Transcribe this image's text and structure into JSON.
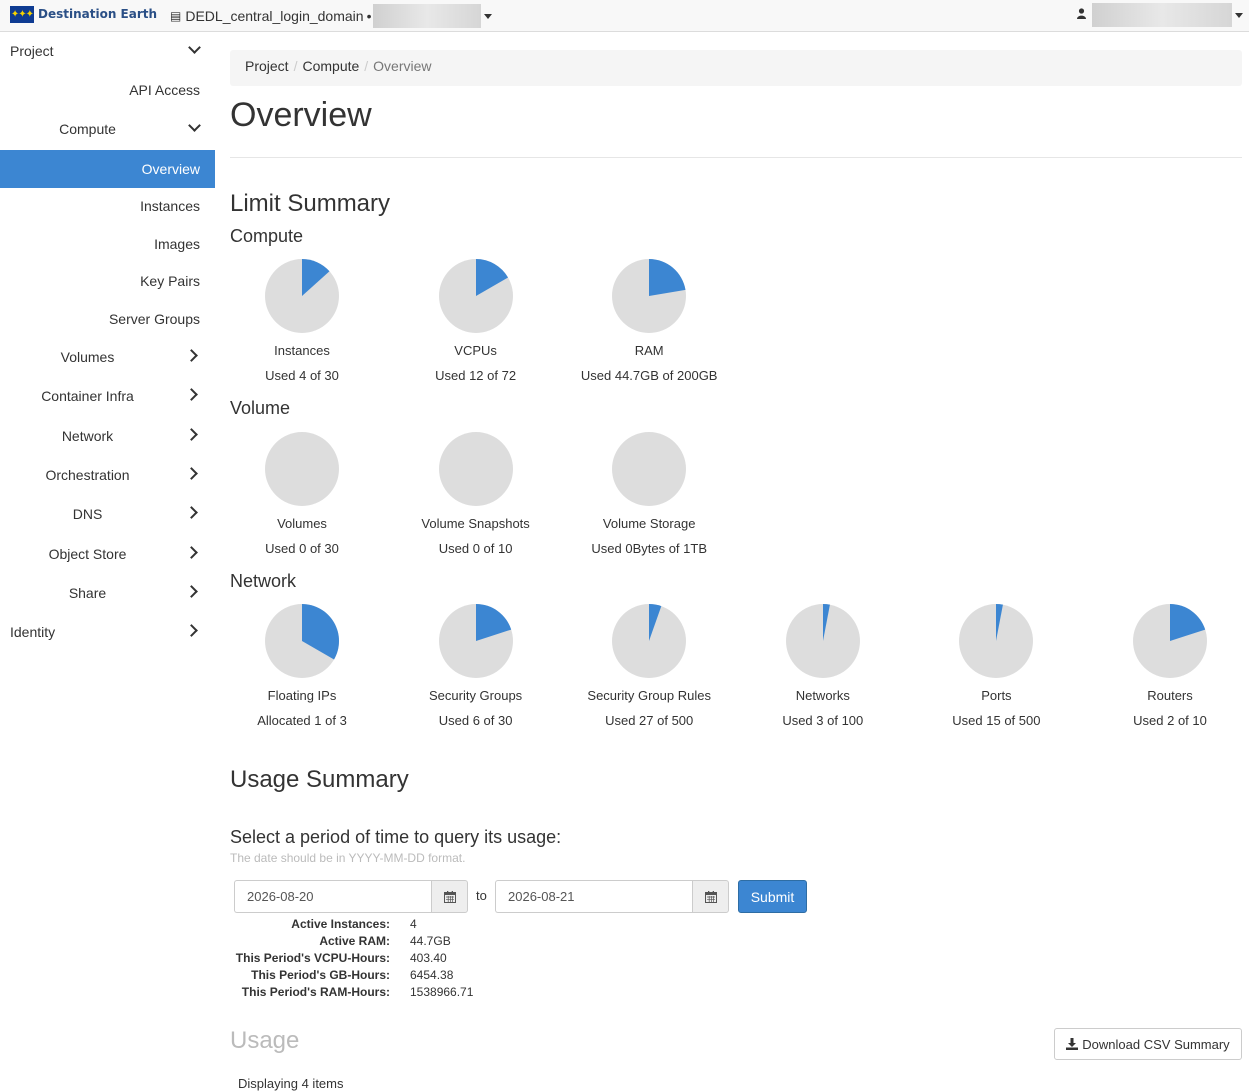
{
  "navbar": {
    "brand": "Destination Earth",
    "domain": "DEDL_central_login_domain",
    "domain_sep": "•"
  },
  "sidebar": {
    "project": "Project",
    "api_access": "API Access",
    "compute": "Compute",
    "overview": "Overview",
    "instances": "Instances",
    "images": "Images",
    "key_pairs": "Key Pairs",
    "server_groups": "Server Groups",
    "volumes": "Volumes",
    "container_infra": "Container Infra",
    "network": "Network",
    "orchestration": "Orchestration",
    "dns": "DNS",
    "object_store": "Object Store",
    "share": "Share",
    "identity": "Identity"
  },
  "breadcrumb": {
    "project": "Project",
    "compute": "Compute",
    "current": "Overview",
    "sep": "/"
  },
  "page_title": "Overview",
  "limit_summary": {
    "title": "Limit Summary",
    "compute": {
      "heading": "Compute",
      "items": [
        {
          "label": "Instances",
          "text": "Used 4 of 30",
          "used": 4,
          "total": 30
        },
        {
          "label": "VCPUs",
          "text": "Used 12 of 72",
          "used": 12,
          "total": 72
        },
        {
          "label": "RAM",
          "text": "Used 44.7GB of 200GB",
          "used": 44.7,
          "total": 200
        }
      ]
    },
    "volume": {
      "heading": "Volume",
      "items": [
        {
          "label": "Volumes",
          "text": "Used 0 of 30",
          "used": 0,
          "total": 30
        },
        {
          "label": "Volume Snapshots",
          "text": "Used 0 of 10",
          "used": 0,
          "total": 10
        },
        {
          "label": "Volume Storage",
          "text": "Used 0Bytes of 1TB",
          "used": 0,
          "total": 1
        }
      ]
    },
    "network": {
      "heading": "Network",
      "items": [
        {
          "label": "Floating IPs",
          "text": "Allocated 1 of 3",
          "used": 1,
          "total": 3
        },
        {
          "label": "Security Groups",
          "text": "Used 6 of 30",
          "used": 6,
          "total": 30
        },
        {
          "label": "Security Group Rules",
          "text": "Used 27 of 500",
          "used": 27,
          "total": 500
        },
        {
          "label": "Networks",
          "text": "Used 3 of 100",
          "used": 3,
          "total": 100
        },
        {
          "label": "Ports",
          "text": "Used 15 of 500",
          "used": 15,
          "total": 500
        },
        {
          "label": "Routers",
          "text": "Used 2 of 10",
          "used": 2,
          "total": 10
        }
      ]
    }
  },
  "colors": {
    "used": "#3c86d2",
    "free": "#dddddd",
    "accent": "#3c86d2"
  },
  "usage_summary": {
    "title": "Usage Summary",
    "period_title": "Select a period of time to query its usage:",
    "help": "The date should be in YYYY-MM-DD format.",
    "start": "2026-08-20",
    "end": "2026-08-21",
    "to": "to",
    "submit": "Submit",
    "stats": [
      {
        "k": "Active Instances:",
        "v": "4"
      },
      {
        "k": "Active RAM:",
        "v": "44.7GB"
      },
      {
        "k": "This Period's VCPU-Hours:",
        "v": "403.40"
      },
      {
        "k": "This Period's GB-Hours:",
        "v": "6454.38"
      },
      {
        "k": "This Period's RAM-Hours:",
        "v": "1538966.71"
      }
    ]
  },
  "usage": {
    "title": "Usage",
    "download": "Download CSV Summary",
    "displaying": "Displaying 4 items"
  },
  "icons": {
    "domain": "id-card-icon",
    "user": "user-icon",
    "calendar": "calendar-icon",
    "download": "download-icon"
  }
}
